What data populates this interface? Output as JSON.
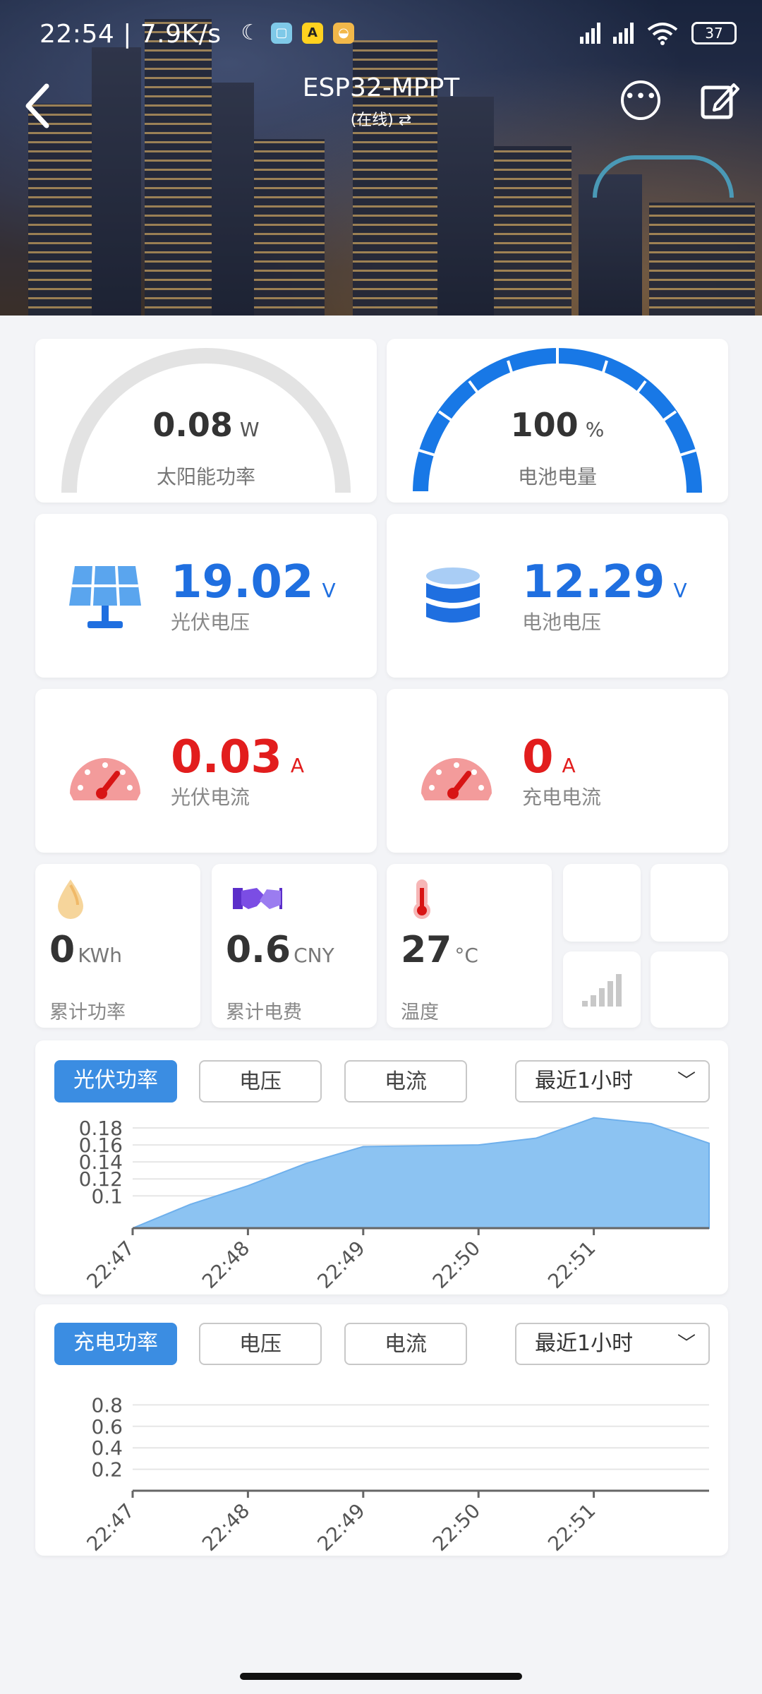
{
  "status_bar": {
    "time_speed": "22:54 | 7.9K/s",
    "battery": "37"
  },
  "nav": {
    "title": "ESP32-MPPT",
    "subtitle": "(在线) ⇄"
  },
  "gauges": [
    {
      "value": "0.08",
      "unit": "W",
      "label": "太阳能功率",
      "level": 0.0
    },
    {
      "value": "100",
      "unit": "%",
      "label": "电池电量",
      "level": 1.0
    }
  ],
  "metrics": {
    "pv_voltage": {
      "value": "19.02",
      "unit": "V",
      "label": "光伏电压"
    },
    "battery_voltage": {
      "value": "12.29",
      "unit": "V",
      "label": "电池电压"
    },
    "pv_current": {
      "value": "0.03",
      "unit": "A",
      "label": "光伏电流"
    },
    "charge_current": {
      "value": "0",
      "unit": "A",
      "label": "充电电流"
    }
  },
  "small_stats": {
    "energy": {
      "value": "0",
      "unit": "KWh",
      "label": "累计功率"
    },
    "cost": {
      "value": "0.6",
      "unit": "CNY",
      "label": "累计电费"
    },
    "temperature": {
      "value": "27",
      "unit": "°C",
      "label": "温度"
    }
  },
  "chart1_tabs": {
    "active": "光伏功率",
    "voltage": "电压",
    "current": "电流",
    "range": "最近1小时"
  },
  "chart2_tabs": {
    "active": "充电功率",
    "voltage": "电压",
    "current": "电流",
    "range": "最近1小时"
  },
  "colors": {
    "accent": "#3b8de2",
    "value_blue": "#1f6fe0",
    "value_red": "#e21d1d",
    "area_fill": "#8cc3f2"
  },
  "chart_data": [
    {
      "type": "area",
      "title": "光伏功率",
      "x": [
        "22:47",
        "22:47:30",
        "22:48",
        "22:48:30",
        "22:49",
        "22:49:30",
        "22:50",
        "22:50:30",
        "22:51",
        "22:51:30",
        "22:52"
      ],
      "x_ticks": [
        "22:47",
        "22:48",
        "22:49",
        "22:50",
        "22:51"
      ],
      "y_ticks": [
        "0.1",
        "0.12",
        "0.14",
        "0.16",
        "0.18"
      ],
      "series": [
        {
          "values": [
            0.062,
            0.09,
            0.112,
            0.138,
            0.158,
            0.159,
            0.16,
            0.168,
            0.192,
            0.185,
            0.162
          ]
        }
      ],
      "ylim": [
        0.062,
        0.2
      ],
      "grid": true
    },
    {
      "type": "line",
      "title": "充电功率",
      "x_ticks": [
        "22:47",
        "22:48",
        "22:49",
        "22:50",
        "22:51"
      ],
      "y_ticks": [
        "0.2",
        "0.4",
        "0.6",
        "0.8"
      ],
      "series": [],
      "ylim": [
        0,
        1
      ],
      "grid": true
    }
  ]
}
